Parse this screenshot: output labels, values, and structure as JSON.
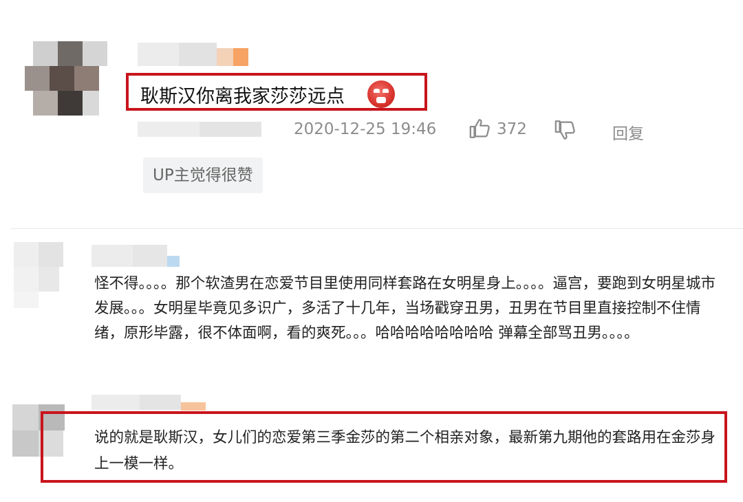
{
  "comments": [
    {
      "text": "耿斯汉你离我家莎莎远点",
      "emoji": "angry-face-icon",
      "timestamp": "2020-12-25 19:46",
      "likes": "372",
      "reply_label": "回复",
      "badge": "UP主觉得很赞"
    },
    {
      "text": "怪不得。。。。那个软渣男在恋爱节目里使用同样套路在女明星身上。。。。逼宫，要跑到女明星城市发展。。。女明星毕竟见多识广，多活了十几年，当场戳穿丑男，丑男在节目里直接控制不住情绪，原形毕露，很不体面啊，看的爽死。。。哈哈哈哈哈哈哈哈 弹幕全部骂丑男。。。。"
    },
    {
      "text": "说的就是耿斯汉，女儿们的恋爱第三季金莎的第二个相亲对象，最新第九期他的套路用在金莎身上一模一样。"
    }
  ],
  "colors": {
    "highlight_border": "#c8141c",
    "meta_text": "#8c8c8c",
    "badge_bg": "#f1f2f3"
  }
}
